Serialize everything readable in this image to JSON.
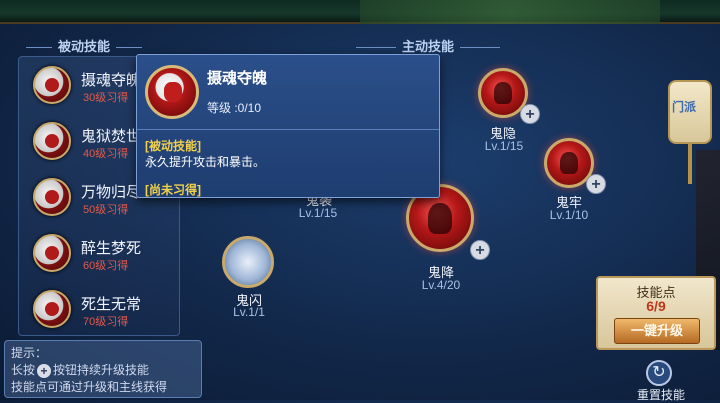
{
  "headers": {
    "passive": "被动技能",
    "active": "主动技能"
  },
  "passive_skills": [
    {
      "name": "摄魂夺魄",
      "requirement": "30级习得"
    },
    {
      "name": "鬼狱焚世",
      "requirement": "40级习得"
    },
    {
      "name": "万物归尽",
      "requirement": "50级习得"
    },
    {
      "name": "醉生梦死",
      "requirement": "60级习得"
    },
    {
      "name": "死生无常",
      "requirement": "70级习得"
    }
  ],
  "tips": {
    "title": "提示：",
    "line1_prefix": "长按",
    "line1_suffix": "按钮持续升级技能",
    "line2": "技能点可通过升级和主线获得"
  },
  "tooltip": {
    "title": "摄魂夺魄",
    "level": "等级 :0/10",
    "type": "[被动技能]",
    "description": "永久提升攻击和暴击。",
    "status": "[尚未习得]"
  },
  "active_skills": {
    "guiyin": {
      "name": "鬼隐",
      "level": "Lv.1/15"
    },
    "guilao": {
      "name": "鬼牢",
      "level": "Lv.1/10"
    },
    "guixi": {
      "name": "鬼袭",
      "level": "Lv.1/15"
    },
    "guijiang": {
      "name": "鬼降",
      "level": "Lv.4/20"
    },
    "guishan": {
      "name": "鬼闪",
      "level": "Lv.1/1"
    }
  },
  "right_panel": {
    "faction_label": "门派",
    "skill_points_label": "技能点",
    "skill_points_value": "6/9",
    "one_key_upgrade": "一键升级",
    "reset_label": "重置技能"
  },
  "icons": {
    "plus": "+",
    "reset": "↻"
  }
}
